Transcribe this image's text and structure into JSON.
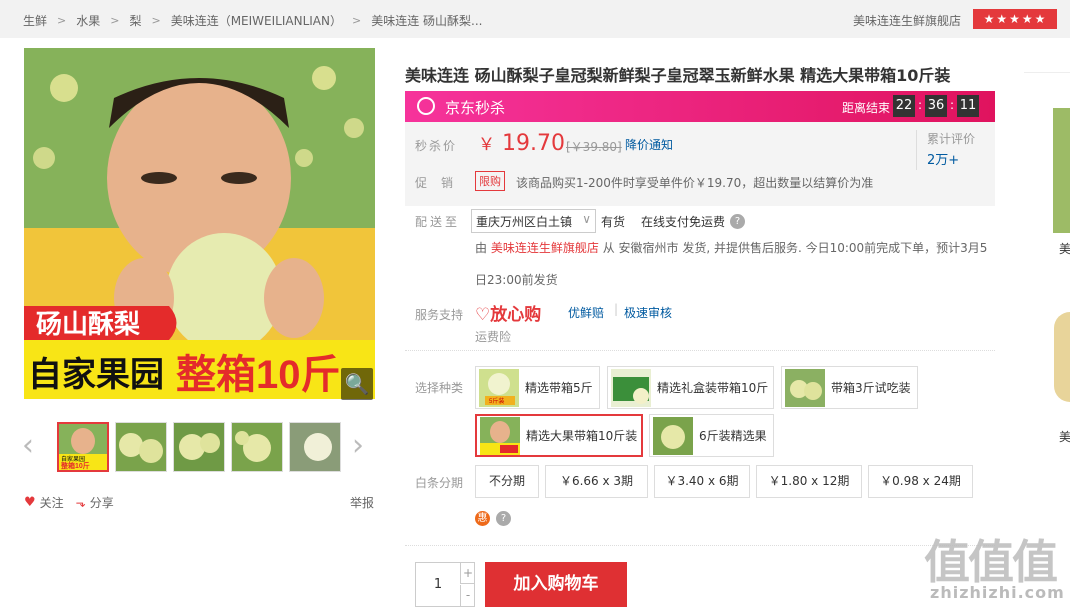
{
  "breadcrumb": [
    "生鲜",
    "水果",
    "梨",
    "美味连连（MEIWEILIANLIAN）",
    "美味连连 砀山酥梨..."
  ],
  "shop_name": "美味连连生鲜旗舰店",
  "shop_rating_stars": 4.5,
  "product": {
    "title": "美味连连 砀山酥梨子皇冠梨新鲜梨子皇冠翠玉新鲜水果 精选大果带箱10斤装",
    "image_text_top": "砀山酥梨",
    "image_text_bottom_a": "自家果园",
    "image_text_bottom_b": "整箱10斤",
    "thumb_caption_a": "自家果园",
    "thumb_caption_b": "整箱10斤"
  },
  "seckill": {
    "label": "京东秒杀",
    "ends_label": "距离结束",
    "hours": "22",
    "minutes": "36",
    "seconds": "11"
  },
  "price": {
    "label": "秒杀价",
    "currency": "￥",
    "value": "19.70",
    "original": "[￥39.80]",
    "notify": "降价通知",
    "reviews_label": "累计评价",
    "reviews_count": "2万+",
    "promo_label": "促销",
    "promo_tag": "限购",
    "promo_text": "该商品购买1-200件时享受单件价￥19.70，超出数量以结算价为准"
  },
  "delivery": {
    "label": "配送至",
    "area": "重庆万州区白土镇",
    "stock": "有货",
    "cod": "在线支付免运费",
    "info_prefix": "由",
    "info_shop": "美味连连生鲜旗舰店",
    "info_line1": "从 安徽宿州市 发货, 并提供售后服务. 今日10:00前完成下单，预计3月5",
    "info_line2": "日23:00前发货"
  },
  "service": {
    "label": "服务支持",
    "brand": "放心购",
    "items": [
      "优鲜赔",
      "极速审核",
      "运费险"
    ]
  },
  "variants": {
    "label": "选择种类",
    "options": [
      "精选带箱5斤",
      "精选礼盒装带箱10斤",
      "带箱3斤试吃装",
      "精选大果带箱10斤装",
      "6斤装精选果"
    ],
    "mini_caption": "5斤装"
  },
  "installment": {
    "label": "白条分期",
    "options": [
      "不分期",
      "￥6.66 x 3期",
      "￥3.40 x 6期",
      "￥1.80 x 12期",
      "￥0.98 x 24期"
    ],
    "hui": "惠"
  },
  "cart": {
    "quantity": "1",
    "plus": "+",
    "minus": "-",
    "button": "加入购物车"
  },
  "actions": {
    "follow": "关注",
    "share": "分享",
    "report": "举报"
  },
  "side_text": "美",
  "watermark": {
    "big": "值值值",
    "small": "zhizhizhi.com"
  },
  "colors": {
    "accent": "#e4393c",
    "seckill_start": "#f6339b",
    "seckill_end": "#e0135e",
    "link": "#005aa0"
  }
}
